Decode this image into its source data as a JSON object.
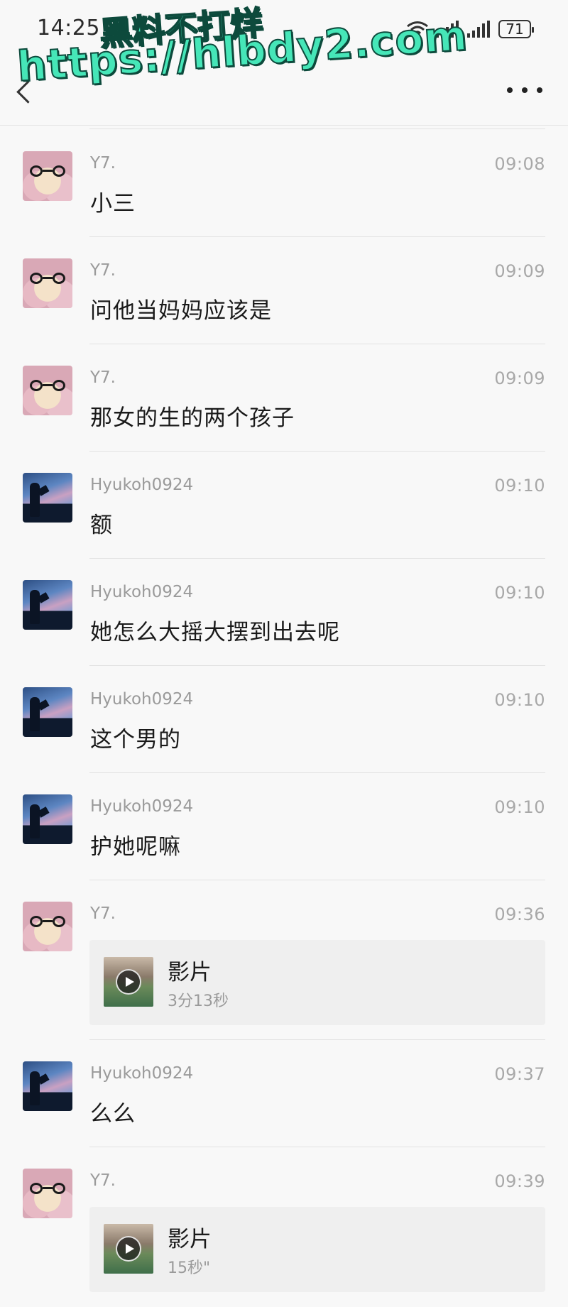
{
  "status_bar": {
    "time": "14:25",
    "battery": "71",
    "icons": [
      "wifi-icon",
      "signal-icon",
      "signal-icon",
      "battery-icon"
    ]
  },
  "watermark": {
    "line1": "黑料不打烊",
    "line2": "https://hlbdy2.com"
  },
  "header": {
    "back_icon": "chevron-left-icon",
    "more_icon": "more-horizontal-icon"
  },
  "messages": [
    {
      "sender": "Y7.",
      "time": "09:08",
      "text": "小三",
      "avatar": "bear"
    },
    {
      "sender": "Y7.",
      "time": "09:09",
      "text": "问他当妈妈应该是",
      "avatar": "bear"
    },
    {
      "sender": "Y7.",
      "time": "09:09",
      "text": "那女的生的两个孩子",
      "avatar": "bear"
    },
    {
      "sender": "Hyukoh0924",
      "time": "09:10",
      "text": "额",
      "avatar": "landscape"
    },
    {
      "sender": "Hyukoh0924",
      "time": "09:10",
      "text": "她怎么大摇大摆到出去呢",
      "avatar": "landscape"
    },
    {
      "sender": "Hyukoh0924",
      "time": "09:10",
      "text": "这个男的",
      "avatar": "landscape"
    },
    {
      "sender": "Hyukoh0924",
      "time": "09:10",
      "text": "护她呢嘛",
      "avatar": "landscape"
    },
    {
      "sender": "Y7.",
      "time": "09:36",
      "video_title": "影片",
      "video_duration": "3分13秒",
      "avatar": "bear"
    },
    {
      "sender": "Hyukoh0924",
      "time": "09:37",
      "text": "么么",
      "avatar": "landscape"
    },
    {
      "sender": "Y7.",
      "time": "09:39",
      "video_title": "影片",
      "video_duration": "15秒\"",
      "avatar": "bear"
    }
  ]
}
